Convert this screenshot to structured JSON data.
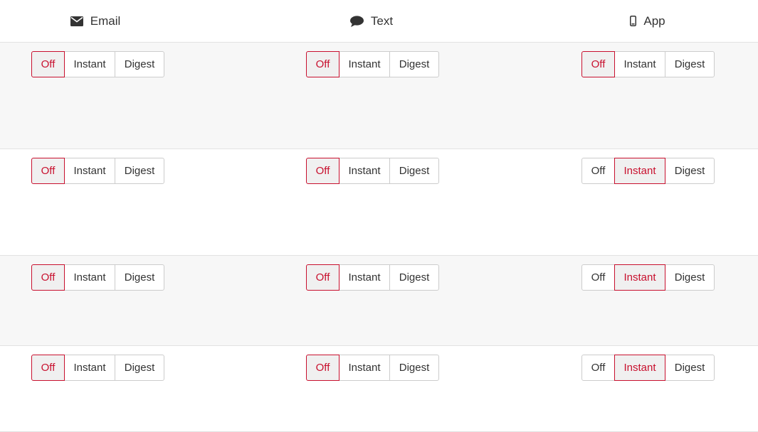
{
  "columns": [
    {
      "label": "Email",
      "icon": "envelope-icon"
    },
    {
      "label": "Text",
      "icon": "speech-bubble-icon"
    },
    {
      "label": "App",
      "icon": "mobile-phone-icon"
    }
  ],
  "options": [
    "Off",
    "Instant",
    "Digest"
  ],
  "colors": {
    "active": "#c8102e",
    "active_bg": "#f0f0f0",
    "alt_row_bg": "#f7f7f7",
    "border": "#cccccc"
  },
  "rows": [
    {
      "selected": [
        "Off",
        "Off",
        "Off"
      ]
    },
    {
      "selected": [
        "Off",
        "Off",
        "Instant"
      ]
    },
    {
      "selected": [
        "Off",
        "Off",
        "Instant"
      ]
    },
    {
      "selected": [
        "Off",
        "Off",
        "Instant"
      ]
    }
  ]
}
